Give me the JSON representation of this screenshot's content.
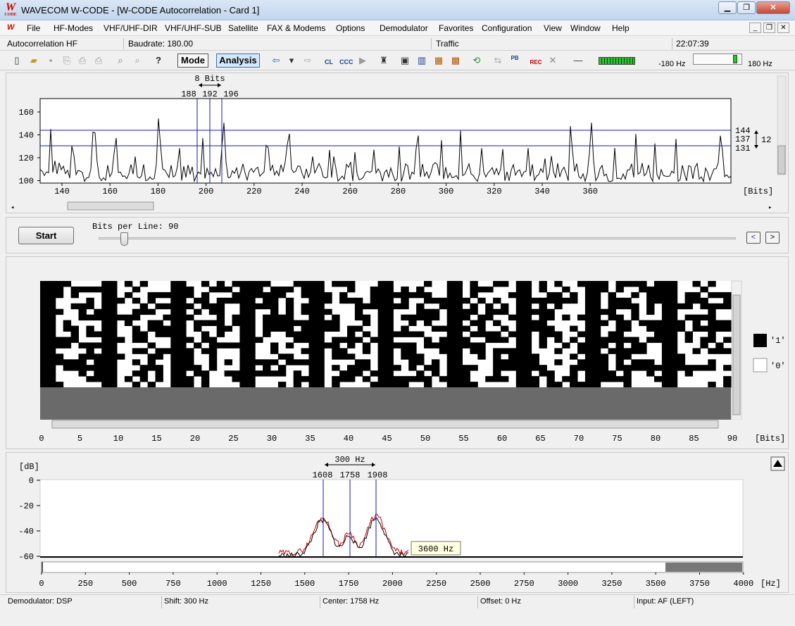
{
  "window": {
    "title": "WAVECOM W-CODE - [W-CODE Autocorrelation  - Card 1]",
    "logo_text": "W",
    "logo_sub": "CODE"
  },
  "menu": [
    "File",
    "HF-Modes",
    "VHF/UHF-DIR",
    "VHF/UHF-SUB",
    "Satellite",
    "FAX & Modems",
    "Options",
    "Demodulator",
    "Favorites",
    "Configuration",
    "View",
    "Window",
    "Help"
  ],
  "info": {
    "mode": "Autocorrelation HF",
    "baudrate": "Baudrate: 180.00",
    "traffic": "Traffic",
    "time": "22:07:39"
  },
  "toolbar": {
    "mode_label": "Mode",
    "analysis_label": "Analysis",
    "cl_label": "CL",
    "ccc_label": "CCC",
    "pb_label": "PB",
    "rec_label": "REC",
    "freq_left": "-180 Hz",
    "freq_right": "180 Hz"
  },
  "autocorr": {
    "bits_marker": "8 Bits",
    "marker_labels": [
      "188",
      "192",
      "196"
    ],
    "right_labels": [
      "144",
      "137",
      "131"
    ],
    "right_diff": "12",
    "y_ticks": [
      "160",
      "140",
      "120",
      "100"
    ],
    "x_ticks": [
      "140",
      "160",
      "180",
      "200",
      "220",
      "240",
      "260",
      "280",
      "300",
      "320",
      "340",
      "360"
    ],
    "x_unit": "[Bits]"
  },
  "controls": {
    "start_label": "Start",
    "bits_per_line": "Bits per Line: 90",
    "prev": "<",
    "next": ">"
  },
  "bitmap": {
    "x_ticks": [
      "0",
      "5",
      "10",
      "15",
      "20",
      "25",
      "30",
      "35",
      "40",
      "45",
      "50",
      "55",
      "60",
      "65",
      "70",
      "75",
      "80",
      "85",
      "90"
    ],
    "x_unit": "[Bits]",
    "legend_one": "'1'",
    "legend_zero": "'0'"
  },
  "spectrum": {
    "y_unit": "[dB]",
    "y_ticks": [
      "0",
      "-20",
      "-40",
      "-60"
    ],
    "shift_label": "300 Hz",
    "marker_labels": [
      "1608",
      "1758",
      "1908"
    ],
    "tooltip": "3600 Hz",
    "x_ticks": [
      "0",
      "250",
      "500",
      "750",
      "1000",
      "1250",
      "1500",
      "1750",
      "2000",
      "2250",
      "2500",
      "2750",
      "3000",
      "3250",
      "3500",
      "3750",
      "4000"
    ],
    "x_unit": "[Hz]"
  },
  "status": {
    "demodulator": "Demodulator: DSP",
    "shift": "Shift: 300 Hz",
    "center": "Center: 1758 Hz",
    "offset": "Offset: 0 Hz",
    "input": "Input: AF (LEFT)"
  },
  "colors": {
    "marker": "#1a1aa8",
    "spectrum_red": "#cc0000",
    "bit_one": "#000000",
    "bit_zero": "#ffffff"
  }
}
